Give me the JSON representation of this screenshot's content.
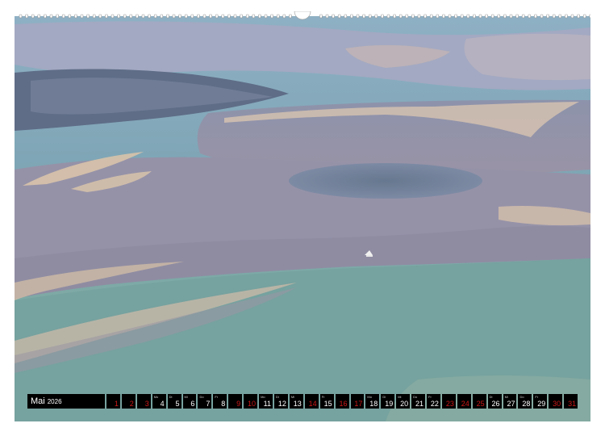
{
  "calendar": {
    "month": "Mai",
    "year": "2026",
    "days": [
      {
        "n": "1",
        "w": "",
        "red": true
      },
      {
        "n": "2",
        "w": "",
        "red": true
      },
      {
        "n": "3",
        "w": "",
        "red": true
      },
      {
        "n": "4",
        "w": "Mo",
        "red": false
      },
      {
        "n": "5",
        "w": "Di",
        "red": false
      },
      {
        "n": "6",
        "w": "Mi",
        "red": false
      },
      {
        "n": "7",
        "w": "Do",
        "red": false
      },
      {
        "n": "8",
        "w": "Fr",
        "red": false
      },
      {
        "n": "9",
        "w": "",
        "red": true
      },
      {
        "n": "10",
        "w": "",
        "red": true
      },
      {
        "n": "11",
        "w": "Mo",
        "red": false
      },
      {
        "n": "12",
        "w": "Di",
        "red": false
      },
      {
        "n": "13",
        "w": "Mi",
        "red": false
      },
      {
        "n": "14",
        "w": "",
        "red": true
      },
      {
        "n": "15",
        "w": "Fr",
        "red": false
      },
      {
        "n": "16",
        "w": "",
        "red": true
      },
      {
        "n": "17",
        "w": "",
        "red": true
      },
      {
        "n": "18",
        "w": "Mo",
        "red": false
      },
      {
        "n": "19",
        "w": "Di",
        "red": false
      },
      {
        "n": "20",
        "w": "Mi",
        "red": false
      },
      {
        "n": "21",
        "w": "Do",
        "red": false
      },
      {
        "n": "22",
        "w": "Fr",
        "red": false
      },
      {
        "n": "23",
        "w": "",
        "red": true
      },
      {
        "n": "24",
        "w": "",
        "red": true
      },
      {
        "n": "25",
        "w": "",
        "red": true
      },
      {
        "n": "26",
        "w": "Di",
        "red": false
      },
      {
        "n": "27",
        "w": "Mi",
        "red": false
      },
      {
        "n": "28",
        "w": "Do",
        "red": false
      },
      {
        "n": "29",
        "w": "Fr",
        "red": false
      },
      {
        "n": "30",
        "w": "",
        "red": true
      },
      {
        "n": "31",
        "w": "",
        "red": true
      }
    ]
  },
  "colors": {
    "page_background": "#ffffff",
    "calendar_bar": "#000000",
    "weekday_number": "#ffffff",
    "holiday_number": "#d01818"
  }
}
